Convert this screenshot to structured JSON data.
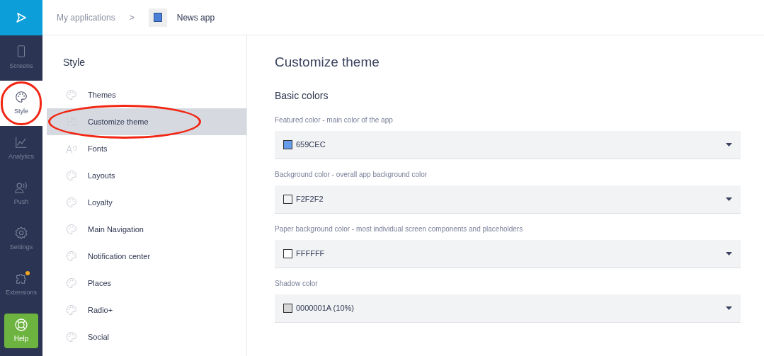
{
  "rail": {
    "items": [
      {
        "label": "Screens",
        "kind": "phone",
        "selected": false,
        "circled": false,
        "badge": false
      },
      {
        "label": "Style",
        "kind": "palette",
        "selected": true,
        "circled": true,
        "badge": false
      },
      {
        "label": "Analytics",
        "kind": "chart",
        "selected": false,
        "circled": false,
        "badge": false
      },
      {
        "label": "Push",
        "kind": "push",
        "selected": false,
        "circled": false,
        "badge": false
      },
      {
        "label": "Settings",
        "kind": "gear",
        "selected": false,
        "circled": false,
        "badge": false
      },
      {
        "label": "Extensions",
        "kind": "puzzle",
        "selected": false,
        "circled": false,
        "badge": true
      }
    ],
    "help": "Help"
  },
  "breadcrumb": {
    "parent": "My applications",
    "separator": ">",
    "current": "News app"
  },
  "style_menu": {
    "title": "Style",
    "items": [
      {
        "label": "Themes",
        "kind": "palette",
        "selected": false,
        "circled": false
      },
      {
        "label": "Customize theme",
        "kind": "sliders",
        "selected": true,
        "circled": true
      },
      {
        "label": "Fonts",
        "kind": "font",
        "selected": false,
        "circled": false
      },
      {
        "label": "Layouts",
        "kind": "palette",
        "selected": false,
        "circled": false
      },
      {
        "label": "Loyalty",
        "kind": "palette",
        "selected": false,
        "circled": false
      },
      {
        "label": "Main Navigation",
        "kind": "palette",
        "selected": false,
        "circled": false
      },
      {
        "label": "Notification center",
        "kind": "palette",
        "selected": false,
        "circled": false
      },
      {
        "label": "Places",
        "kind": "palette",
        "selected": false,
        "circled": false
      },
      {
        "label": "Radio+",
        "kind": "palette",
        "selected": false,
        "circled": false
      },
      {
        "label": "Social",
        "kind": "palette",
        "selected": false,
        "circled": false
      }
    ]
  },
  "content": {
    "title": "Customize theme",
    "section": "Basic colors",
    "fields": [
      {
        "label": "Featured color - main color of the app",
        "value": "659CEC",
        "color": "#659cec"
      },
      {
        "label": "Background color - overall app background color",
        "value": "F2F2F2",
        "color": "#f2f2f2"
      },
      {
        "label": "Paper background color - most individual screen components and placeholders",
        "value": "FFFFFF",
        "color": "#ffffff"
      },
      {
        "label": "Shadow color",
        "value": "0000001A (10%)",
        "color": "#d6d6d6"
      }
    ]
  }
}
